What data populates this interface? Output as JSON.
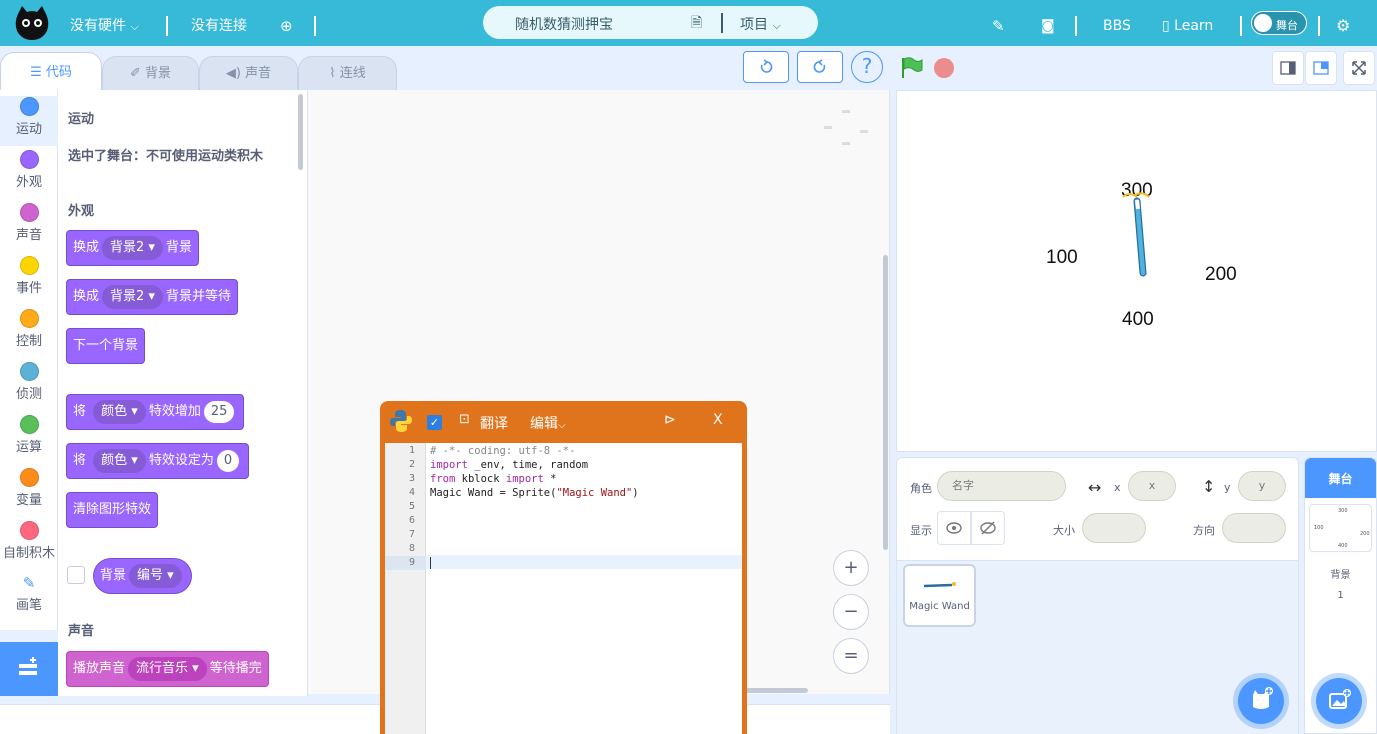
{
  "topbar": {
    "hardware": "没有硬件",
    "connection": "没有连接",
    "project_title": "随机数猜测押宝",
    "project_menu": "项目",
    "bbs": "BBS",
    "learn": "Learn",
    "stage_toggle": "舞台",
    "accent": "#37b9d8"
  },
  "tabs": {
    "code": "代码",
    "backdrop": "背景",
    "sound": "声音",
    "wiring": "连线"
  },
  "help": "?",
  "categories": [
    {
      "label": "运动",
      "color": "#4c97ff"
    },
    {
      "label": "外观",
      "color": "#9966ff"
    },
    {
      "label": "声音",
      "color": "#cf63cf"
    },
    {
      "label": "事件",
      "color": "#ffd500"
    },
    {
      "label": "控制",
      "color": "#ffab19"
    },
    {
      "label": "侦测",
      "color": "#5cb1d6"
    },
    {
      "label": "运算",
      "color": "#59c059"
    },
    {
      "label": "变量",
      "color": "#ff8c1a"
    },
    {
      "label": "自制积木",
      "color": "#ff6680"
    },
    {
      "label": "画笔",
      "color": "#0fbd8c"
    }
  ],
  "palette": {
    "motion_title": "运动",
    "motion_note": "选中了舞台：不可使用运动类积木",
    "looks_title": "外观",
    "b1": {
      "a": "换成",
      "drop": "背景2",
      "b": "背景"
    },
    "b2": {
      "a": "换成",
      "drop": "背景2",
      "b": "背景并等待"
    },
    "b3": "下一个背景",
    "b4": {
      "a": "将",
      "drop": "颜色",
      "b": "特效增加",
      "val": "25"
    },
    "b5": {
      "a": "将",
      "drop": "颜色",
      "b": "特效设定为",
      "val": "0"
    },
    "b6": "清除图形特效",
    "b7": {
      "a": "背景",
      "drop": "编号"
    },
    "sound_title": "声音",
    "b8": {
      "a": "播放声音",
      "drop": "流行音乐",
      "b": "等待播完"
    }
  },
  "python": {
    "translate": "翻译",
    "edit": "编辑",
    "close": "X",
    "lines": [
      "1",
      "2",
      "3",
      "4",
      "5",
      "6",
      "7",
      "8",
      "9"
    ],
    "code": {
      "l1": "# -*- coding: utf-8 -*-",
      "l2a": "import",
      "l2b": " _env, time, random",
      "l3a": "from",
      "l3b": " kblock ",
      "l3c": "import",
      "l3d": " *",
      "l4a": "Magic Wand = Sprite(",
      "l4b": "\"Magic Wand\"",
      "l4c": ")"
    }
  },
  "zoom": {
    "in": "+",
    "out": "−",
    "reset": "="
  },
  "stage": {
    "n300": "300",
    "n100": "100",
    "n200": "200",
    "n400": "400"
  },
  "sprite_info": {
    "sprite_label": "角色",
    "name_placeholder": "名字",
    "x_label": "x",
    "x_placeholder": "x",
    "y_label": "y",
    "y_placeholder": "y",
    "show_label": "显示",
    "size_label": "大小",
    "direction_label": "方向"
  },
  "sprites": [
    {
      "name": "Magic Wand"
    }
  ],
  "stage_panel": {
    "title": "舞台",
    "backdrop_label": "背景",
    "backdrop_count": "1",
    "thumb_300": "300",
    "thumb_100": "100",
    "thumb_200": "200",
    "thumb_400": "400"
  }
}
